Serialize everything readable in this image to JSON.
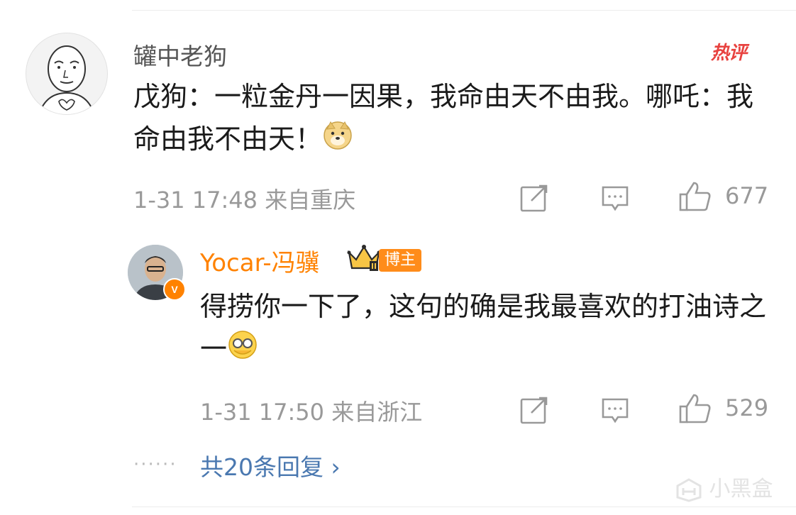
{
  "comment": {
    "username": "罐中老狗",
    "hot_label": "热评",
    "text": "戊狗：一粒金丹一因果，我命由天不由我。哪吒：我命由我不由天！",
    "text_emoji": "doge-emoji",
    "time": "1-31 17:48",
    "location": "来自重庆",
    "likes": "677"
  },
  "reply": {
    "username": "Yocar-冯骥",
    "badge": "博主",
    "verified_letter": "V",
    "text": "得捞你一下了，这句的确是我最喜欢的打油诗之一",
    "text_emoji": "facepalm-glasses-emoji",
    "time": "1-31 17:50",
    "location": "来自浙江",
    "likes": "529"
  },
  "more_replies": {
    "dots": "······",
    "label": "共20条回复",
    "chevron": "›"
  },
  "watermark": "小黑盒",
  "colors": {
    "brand_orange": "#ff8200",
    "hot_red": "#e8423f",
    "link_blue": "#4a78b0",
    "meta_gray": "#999999"
  }
}
